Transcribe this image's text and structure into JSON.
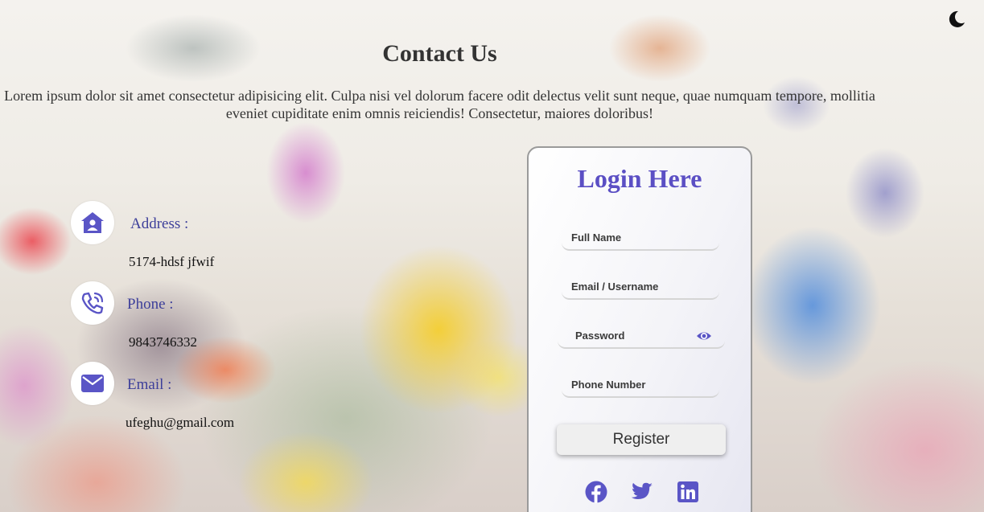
{
  "theme_toggle": {
    "icon": "moon-icon"
  },
  "page": {
    "title": "Contact Us",
    "intro": "Lorem ipsum dolor sit amet consectetur adipisicing elit. Culpa nisi vel dolorum facere odit delectus velit sunt neque, quae numquam tempore, mollitia eveniet cupiditate enim omnis reiciendis! Consectetur, maiores doloribus!"
  },
  "contact": {
    "address": {
      "label": "Address :",
      "value": "5174-hdsf jfwif",
      "icon": "house-user-icon"
    },
    "phone": {
      "label": "Phone :",
      "value": "9843746332",
      "icon": "phone-volume-icon"
    },
    "email": {
      "label": "Email :",
      "value": "ufeghu@gmail.com",
      "icon": "envelope-icon"
    }
  },
  "form": {
    "title": "Login Here",
    "full_name_placeholder": "Full Name",
    "username_placeholder": "Email / Username",
    "password_placeholder": "Password",
    "phone_placeholder": "Phone Number",
    "register_label": "Register"
  },
  "social": [
    "facebook-icon",
    "twitter-icon",
    "linkedin-icon"
  ],
  "colors": {
    "accent": "#5b4fc4",
    "label": "#3d3f9a",
    "icon_fill": "#5a55c6"
  }
}
